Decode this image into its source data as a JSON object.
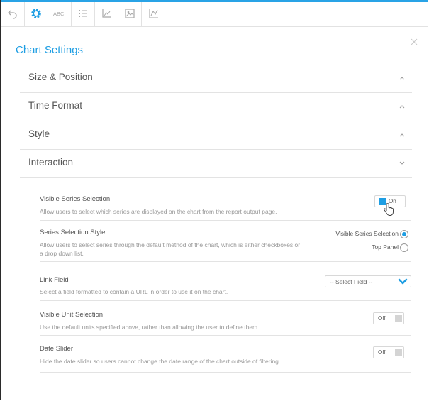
{
  "toolbar": {
    "buttons": [
      {
        "icon": "undo-icon"
      },
      {
        "icon": "gear-icon",
        "active": true
      },
      {
        "icon": "text-abc-icon",
        "text": "ABC"
      },
      {
        "icon": "list-icon"
      },
      {
        "icon": "axis-icon"
      },
      {
        "icon": "image-icon"
      },
      {
        "icon": "line-chart-icon"
      }
    ],
    "accent_color": "#29a3e6"
  },
  "panel": {
    "title": "Chart Settings",
    "close_icon": "close-icon"
  },
  "sections": [
    {
      "label": "Size & Position",
      "state": "collapsed"
    },
    {
      "label": "Time Format",
      "state": "collapsed"
    },
    {
      "label": "Style",
      "state": "collapsed"
    },
    {
      "label": "Interaction",
      "state": "expanded"
    }
  ],
  "interaction": {
    "visible_series": {
      "label": "Visible Series Selection",
      "desc": "Allow users to select which series are displayed on the chart from the report output page.",
      "toggle": "On"
    },
    "series_style": {
      "label": "Series Selection Style",
      "desc": "Allow users to select series through the default method of the chart, which is either checkboxes or a drop down list.",
      "options": [
        {
          "label": "Visible Series Selection",
          "selected": true
        },
        {
          "label": "Top Panel",
          "selected": false
        }
      ]
    },
    "link_field": {
      "label": "Link Field",
      "desc": "Select a field formatted to contain a URL in order to use it on the chart.",
      "value": "-- Select Field --"
    },
    "visible_unit": {
      "label": "Visible Unit Selection",
      "desc": "Use the default units specified above, rather than allowing the user to define them.",
      "toggle": "Off"
    },
    "date_slider": {
      "label": "Date Slider",
      "desc": "Hide the date slider so users cannot change the date range of the chart outside of filtering.",
      "toggle": "Off"
    }
  },
  "colors": {
    "accent": "#1e9ee3",
    "text": "#555555",
    "muted": "#999999"
  }
}
